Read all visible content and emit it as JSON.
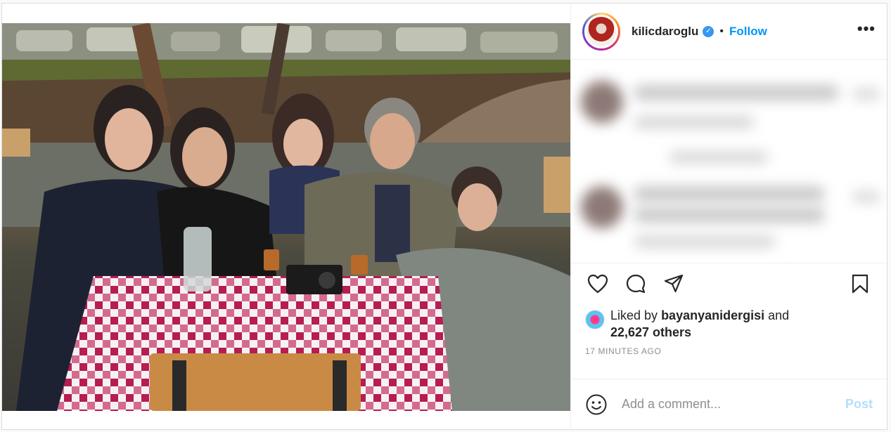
{
  "header": {
    "username": "kilicdaroglu",
    "verified_icon": "verified-badge-icon",
    "separator": "•",
    "follow_label": "Follow",
    "more_icon": "more-options-icon",
    "more_glyph": "•••"
  },
  "actions": {
    "like_icon": "heart-icon",
    "comment_icon": "comment-icon",
    "share_icon": "share-icon",
    "save_icon": "bookmark-icon"
  },
  "likes": {
    "prefix": "Liked by",
    "user": "bayanyanidergisi",
    "and": "and",
    "count": "22,627 others"
  },
  "timestamp": "17 MINUTES AGO",
  "comment_box": {
    "placeholder": "Add a comment...",
    "post_label": "Post",
    "emoji_icon": "smiley-icon"
  },
  "colors": {
    "accent": "#0095f6",
    "post_disabled": "#b2dffc",
    "muted": "#8e8e8e",
    "text": "#262626"
  }
}
